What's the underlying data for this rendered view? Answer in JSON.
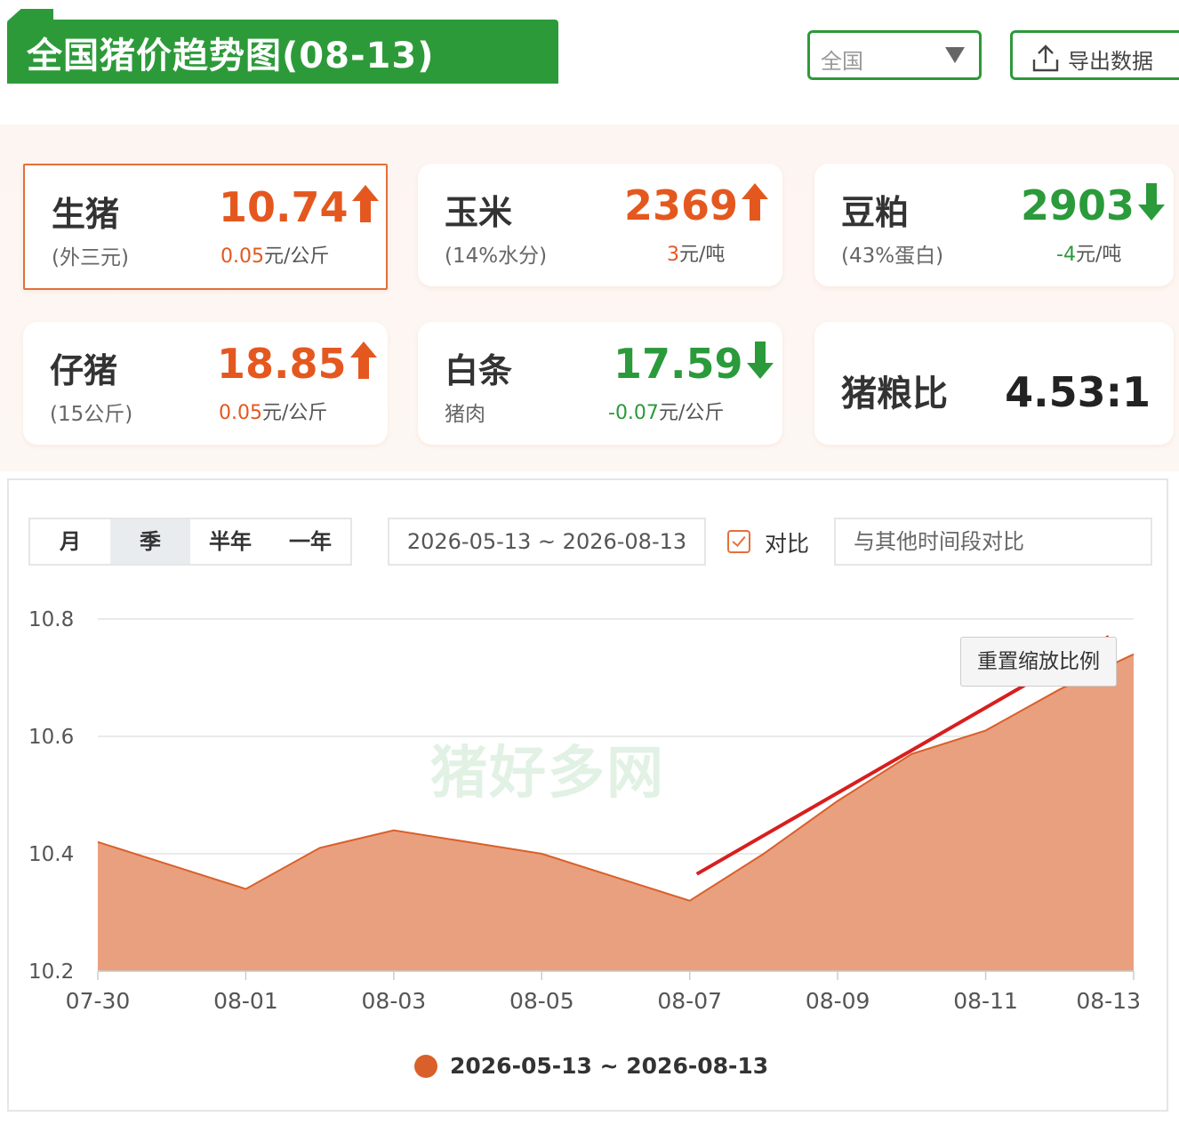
{
  "header": {
    "title": "全国猪价趋势图(08-13)",
    "region_value": "全国",
    "export_label": "导出数据"
  },
  "cards": {
    "live_hog": {
      "name": "生猪",
      "sub": "(外三元)",
      "price": "10.74",
      "change_num": "0.05",
      "change_unit": "元/公斤",
      "direction": "up"
    },
    "corn": {
      "name": "玉米",
      "sub": "(14%水分)",
      "price": "2369",
      "change_num": "3",
      "change_unit": "元/吨",
      "direction": "up"
    },
    "soymeal": {
      "name": "豆粕",
      "sub": "(43%蛋白)",
      "price": "2903",
      "change_num": "-4",
      "change_unit": "元/吨",
      "direction": "down"
    },
    "piglet": {
      "name": "仔猪",
      "sub": "(15公斤)",
      "price": "18.85",
      "change_num": "0.05",
      "change_unit": "元/公斤",
      "direction": "up"
    },
    "pork": {
      "name": "白条",
      "sub": "猪肉",
      "price": "17.59",
      "change_num": "-0.07",
      "change_unit": "元/公斤",
      "direction": "down"
    },
    "ratio": {
      "name": "猪粮比",
      "value": "4.53:1"
    }
  },
  "controls": {
    "tabs": [
      "月",
      "季",
      "半年",
      "一年"
    ],
    "selected_tab": "季",
    "date_range": "2026-05-13 ~ 2026-08-13",
    "compare_checked": true,
    "compare_label": "对比",
    "compare_placeholder": "与其他时间段对比",
    "reset_label": "重置缩放比例"
  },
  "watermark": "猪好多网",
  "colors": {
    "brand_green": "#2d9a3a",
    "up_orange": "#e4581f",
    "down_green": "#2a9a3a",
    "area_fill": "#e9a07e",
    "area_line": "#d9602a",
    "annotation_arrow": "#d81e1e"
  },
  "chart_data": {
    "type": "area",
    "x": [
      "07-30",
      "07-31",
      "08-01",
      "08-02",
      "08-03",
      "08-04",
      "08-05",
      "08-06",
      "08-07",
      "08-08",
      "08-09",
      "08-10",
      "08-11",
      "08-12",
      "08-13"
    ],
    "x_tick_labels": [
      "07-30",
      "08-01",
      "08-03",
      "08-05",
      "08-07",
      "08-09",
      "08-11",
      "08-13"
    ],
    "series": [
      {
        "name": "2026-05-13 ~ 2026-08-13",
        "values": [
          10.42,
          10.38,
          10.34,
          10.41,
          10.44,
          10.42,
          10.4,
          10.36,
          10.32,
          10.4,
          10.49,
          10.57,
          10.61,
          10.68,
          10.74
        ]
      }
    ],
    "ylim": [
      10.2,
      10.8
    ],
    "y_ticks": [
      "10.2",
      "10.4",
      "10.6",
      "10.8"
    ],
    "grid": true,
    "legend_position": "bottom-center"
  }
}
